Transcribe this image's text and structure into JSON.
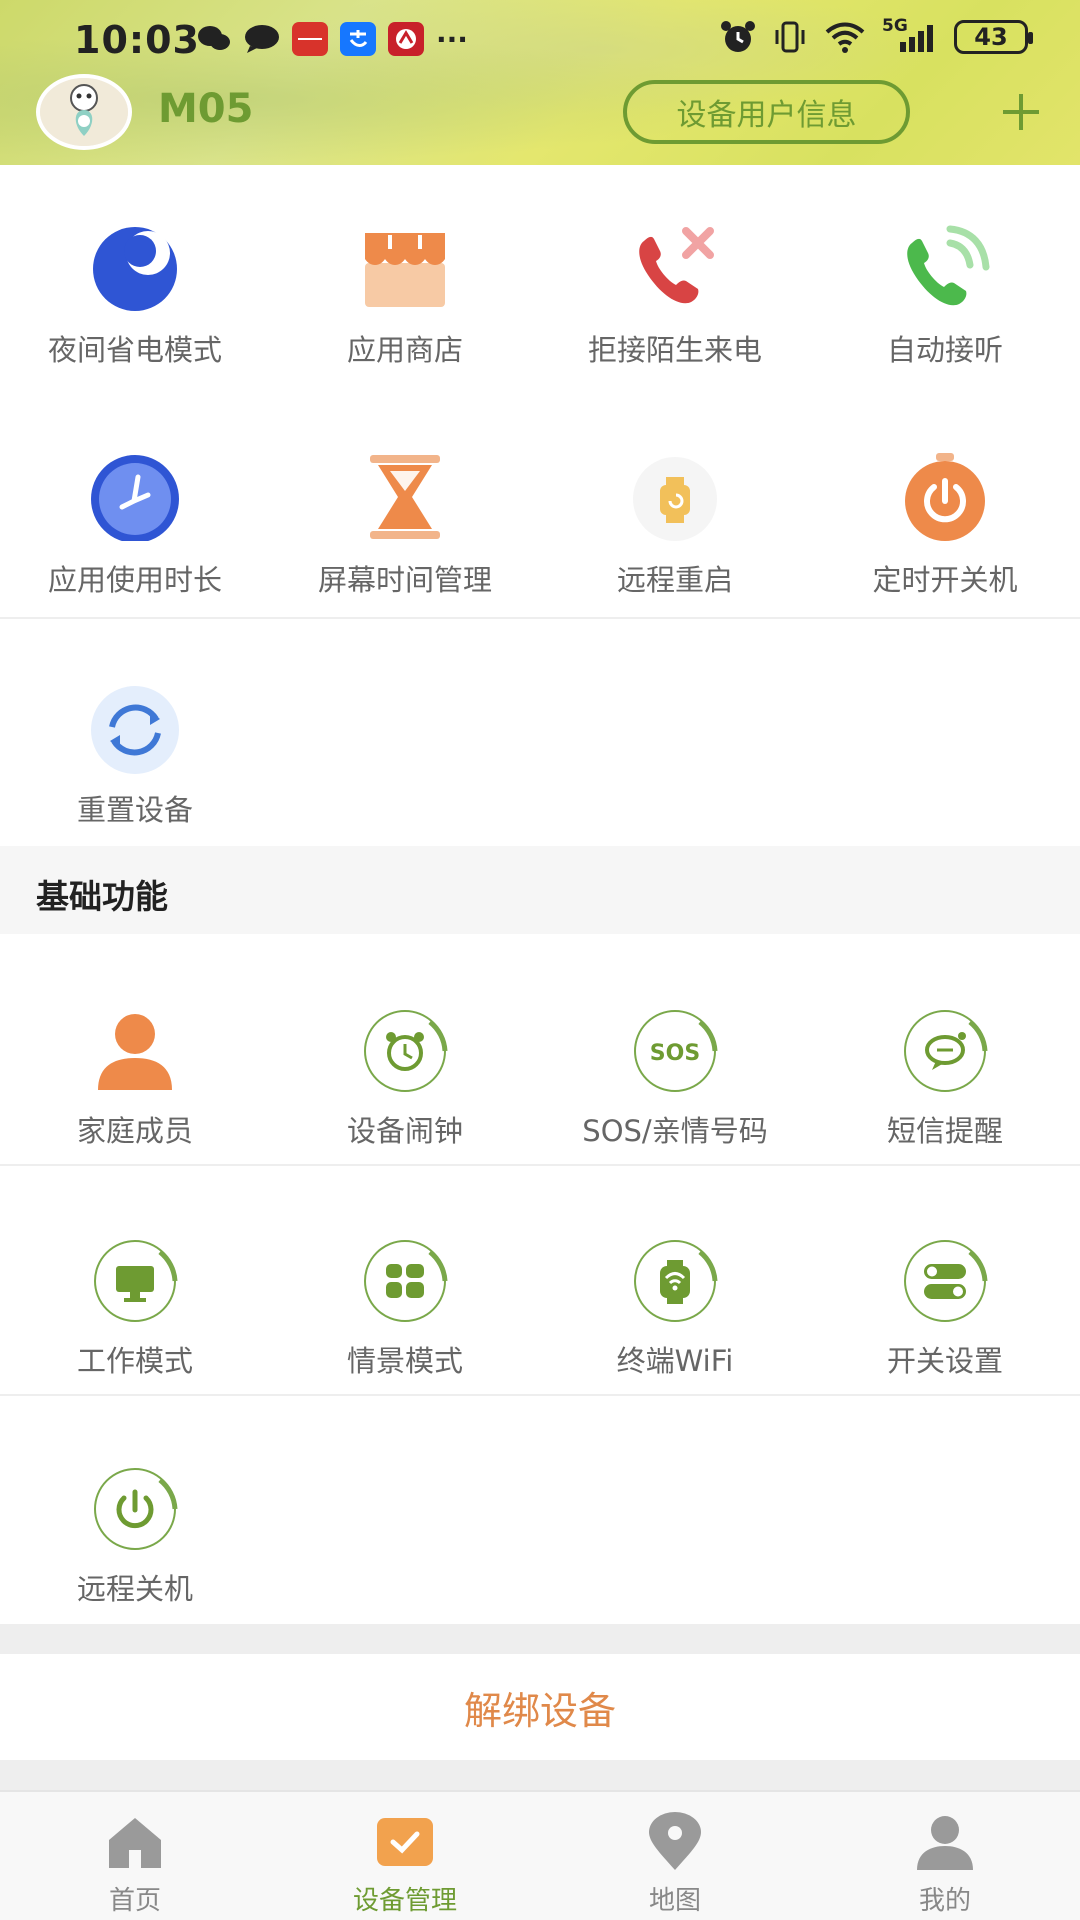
{
  "status_bar": {
    "time": "10:03",
    "network": "5G",
    "battery": "43"
  },
  "header": {
    "device_name": "M05",
    "user_info_button": "设备用户信息",
    "add_button": "+"
  },
  "features": [
    {
      "label": "夜间省电模式",
      "icon": "moon-icon"
    },
    {
      "label": "应用商店",
      "icon": "store-icon"
    },
    {
      "label": "拒接陌生来电",
      "icon": "reject-call-icon"
    },
    {
      "label": "自动接听",
      "icon": "auto-answer-icon"
    },
    {
      "label": "应用使用时长",
      "icon": "clock-icon"
    },
    {
      "label": "屏幕时间管理",
      "icon": "hourglass-icon"
    },
    {
      "label": "远程重启",
      "icon": "restart-watch-icon"
    },
    {
      "label": "定时开关机",
      "icon": "timer-power-icon"
    },
    {
      "label": "重置设备",
      "icon": "reset-icon"
    }
  ],
  "section_title": "基础功能",
  "basic_features": [
    {
      "label": "家庭成员",
      "icon": "person-icon"
    },
    {
      "label": "设备闹钟",
      "icon": "alarm-icon"
    },
    {
      "label": "SOS/亲情号码",
      "icon": "sos-icon"
    },
    {
      "label": "短信提醒",
      "icon": "sms-icon"
    },
    {
      "label": "工作模式",
      "icon": "monitor-icon"
    },
    {
      "label": "情景模式",
      "icon": "grid-icon"
    },
    {
      "label": "终端WiFi",
      "icon": "wifi-watch-icon"
    },
    {
      "label": "开关设置",
      "icon": "toggle-icon"
    },
    {
      "label": "远程关机",
      "icon": "power-icon"
    }
  ],
  "unbind_button": "解绑设备",
  "tabs": [
    {
      "label": "首页",
      "icon": "home-icon",
      "active": false
    },
    {
      "label": "设备管理",
      "icon": "device-manage-icon",
      "active": true
    },
    {
      "label": "地图",
      "icon": "map-pin-icon",
      "active": false
    },
    {
      "label": "我的",
      "icon": "profile-icon",
      "active": false
    }
  ],
  "colors": {
    "accent_green": "#6e9b32",
    "orange": "#e0894a",
    "blue": "#2f55d4"
  }
}
